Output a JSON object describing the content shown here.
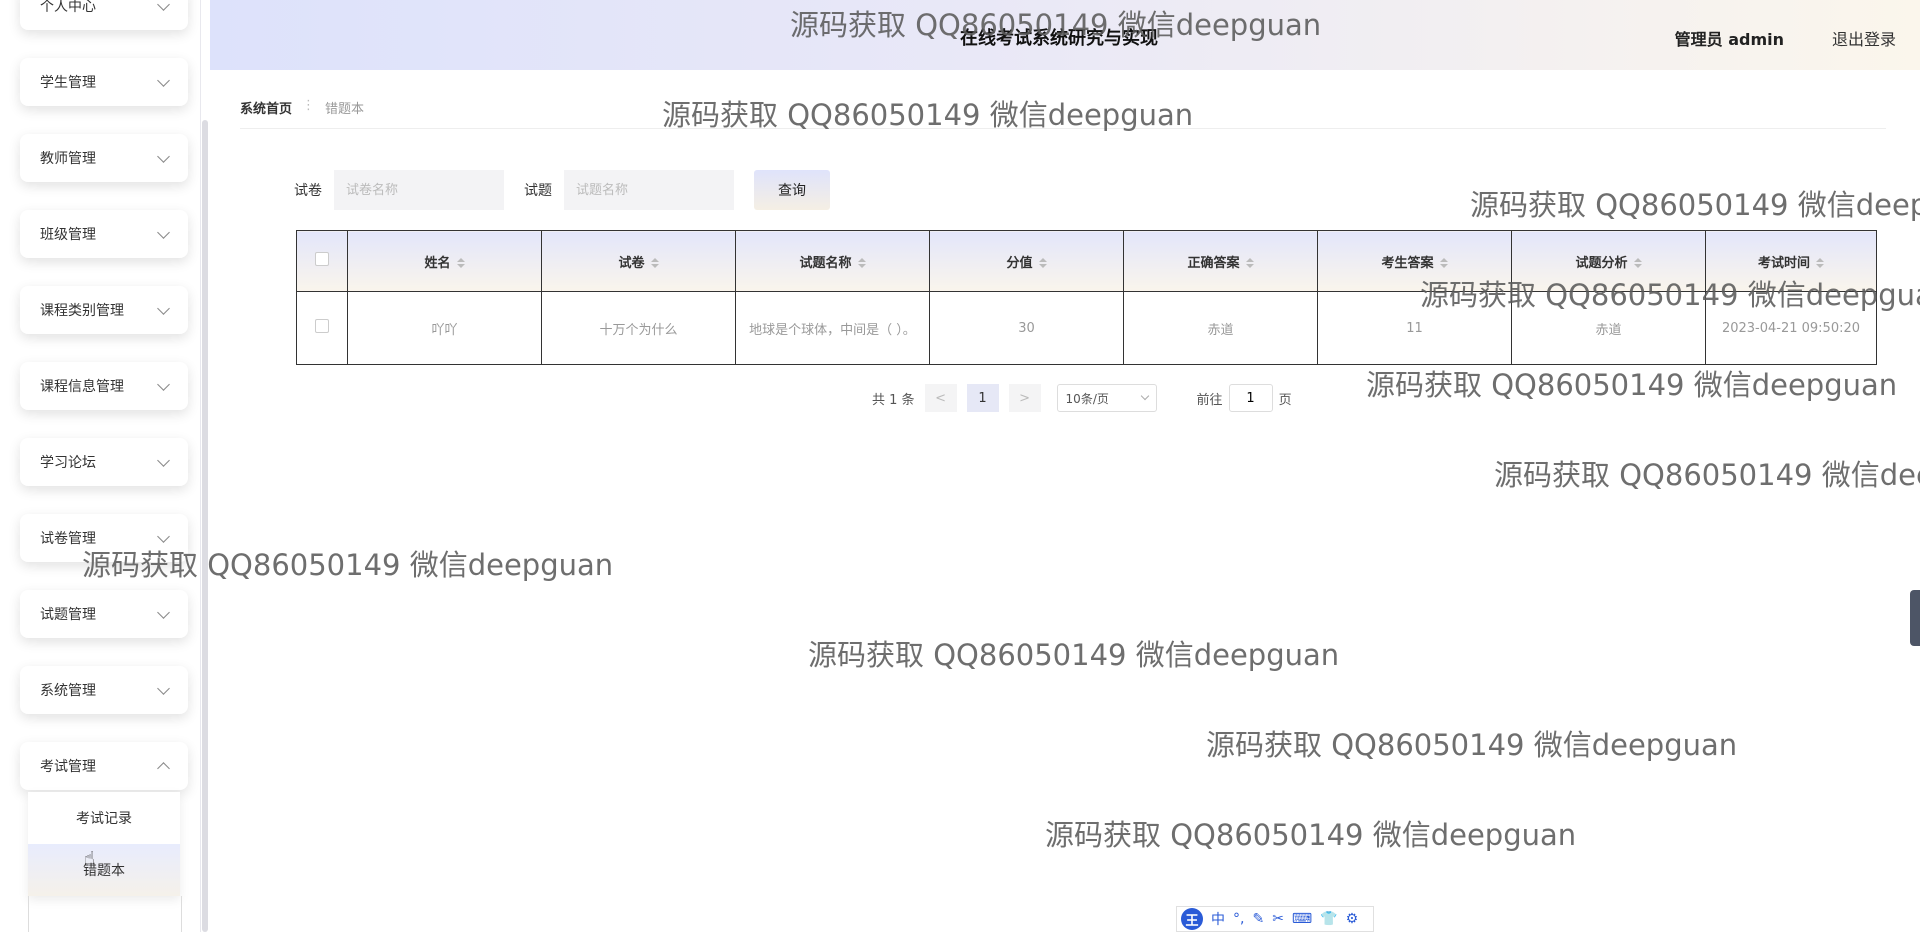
{
  "header": {
    "title": "在线考试系统研究与实现",
    "admin_label": "管理员 admin",
    "logout_label": "退出登录"
  },
  "sidebar": {
    "items": [
      {
        "label": "个人中心"
      },
      {
        "label": "学生管理"
      },
      {
        "label": "教师管理"
      },
      {
        "label": "班级管理"
      },
      {
        "label": "课程类别管理"
      },
      {
        "label": "课程信息管理"
      },
      {
        "label": "学习论坛"
      },
      {
        "label": "试卷管理"
      },
      {
        "label": "试题管理"
      },
      {
        "label": "系统管理"
      },
      {
        "label": "考试管理"
      }
    ],
    "submenu": [
      {
        "label": "考试记录"
      },
      {
        "label": "错题本"
      }
    ]
  },
  "breadcrumb": {
    "home": "系统首页",
    "current": "错题本"
  },
  "search": {
    "paper_label": "试卷",
    "paper_placeholder": "试卷名称",
    "question_label": "试题",
    "question_placeholder": "试题名称",
    "button_label": "查询"
  },
  "table": {
    "headers": [
      "姓名",
      "试卷",
      "试题名称",
      "分值",
      "正确答案",
      "考生答案",
      "试题分析",
      "考试时间"
    ],
    "rows": [
      [
        "吖吖",
        "十万个为什么",
        "地球是个球体，中间是（ ）。",
        "30",
        "赤道",
        "11",
        "赤道",
        "2023-04-21 09:50:20"
      ]
    ]
  },
  "pagination": {
    "total": "共 1 条",
    "prev": "<",
    "page": "1",
    "next": ">",
    "page_size": "10条/页",
    "goto_label": "前往",
    "goto_value": "1",
    "page_unit": "页"
  },
  "watermark": "源码获取 QQ86050149 微信deepguan",
  "ime": {
    "logo": "王",
    "items": [
      "中",
      "°,",
      "✎",
      "✂",
      "⌨",
      "👕",
      "⚙"
    ]
  },
  "colors": {
    "header_gradient_start": "#dde2fb",
    "header_gradient_end": "#fbf6ec",
    "border": "#333333"
  }
}
